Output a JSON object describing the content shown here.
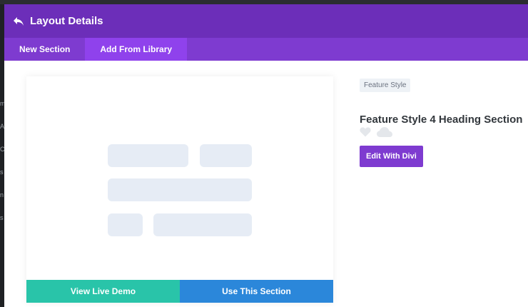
{
  "header": {
    "title": "Layout Details",
    "back_icon": "back-arrow-icon"
  },
  "tabs": [
    {
      "label": "New Section",
      "active": false
    },
    {
      "label": "Add From Library",
      "active": true
    }
  ],
  "card": {
    "demo_button": "View Live Demo",
    "use_button": "Use This Section"
  },
  "details": {
    "category": "Feature Style",
    "title": "Feature Style 4 Heading Section",
    "icons": [
      "heart-icon",
      "cloud-icon"
    ],
    "edit_button": "Edit With Divi"
  },
  "colors": {
    "header": "#6c2eb9",
    "tab_bar": "#7e3bd0",
    "tab_active": "#8f42ec",
    "demo_button": "#29c4a9",
    "use_button": "#2b87da",
    "placeholder": "#e6ecf5"
  },
  "background": {
    "edge_letters": [
      "m",
      "A",
      "C",
      "s",
      "n",
      "s"
    ]
  }
}
